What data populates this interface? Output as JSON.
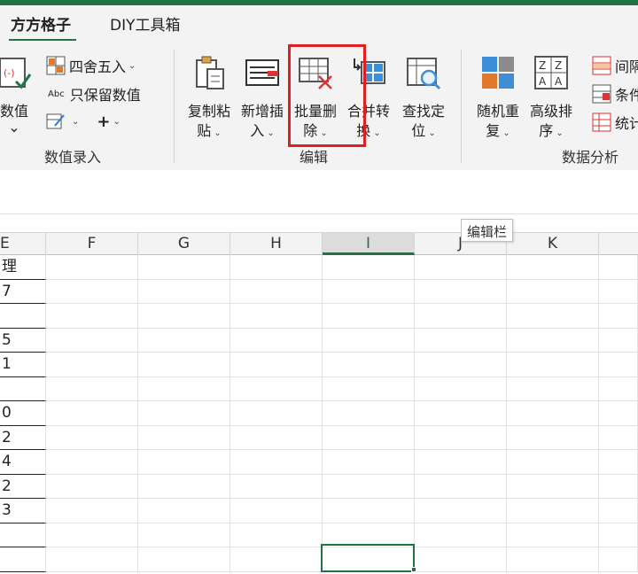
{
  "tabs": [
    {
      "label": "方方格子",
      "active": true
    },
    {
      "label": "DIY工具箱",
      "active": false
    }
  ],
  "groups": {
    "data_entry": {
      "label": "数值录入",
      "number_button": {
        "line1": "数值",
        "line2": "⌄"
      },
      "round_label": "四舍五入",
      "keep_value_label": "只保留数值",
      "abc_text": "Abc"
    },
    "edit": {
      "label": "编辑",
      "copy_paste": {
        "line1": "复制粘",
        "line2": "贴"
      },
      "insert": {
        "line1": "新增插",
        "line2": "入"
      },
      "batch_delete": {
        "line1": "批量删",
        "line2": "除"
      },
      "merge_convert": {
        "line1": "合并转",
        "line2": "换"
      },
      "find_locate": {
        "line1": "查找定",
        "line2": "位"
      }
    },
    "analysis": {
      "label": "数据分析",
      "random_repeat": {
        "line1": "随机重",
        "line2": "复"
      },
      "advanced_sort": {
        "line1": "高级排",
        "line2": "序"
      },
      "interval": "间隔",
      "condition": "条件",
      "stats": "统计"
    }
  },
  "tooltip": "编辑栏",
  "columns": [
    "E",
    "F",
    "G",
    "H",
    "I",
    "J",
    "K"
  ],
  "selected_column": "I",
  "column_e_values": [
    "理",
    "7",
    "",
    "5",
    "1",
    "",
    "0",
    "2",
    "4",
    "2",
    "3",
    "",
    ""
  ],
  "colors": {
    "accent": "#217346",
    "highlight": "#e02020"
  }
}
